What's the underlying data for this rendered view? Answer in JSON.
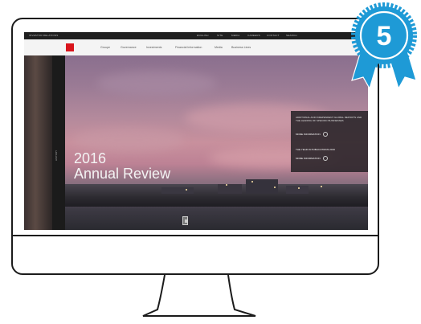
{
  "screen": {
    "top_bar": {
      "left_text": "INVESTOR RELATIONS",
      "right_items": [
        "ENGLISH",
        "SITE",
        "MEDIA",
        "CAREERS",
        "CONTACT",
        "SEARCH"
      ]
    },
    "nav": {
      "items": [
        "Groupe",
        "Governance",
        "Investments",
        "Financial Information",
        "Media",
        "Business Lines"
      ]
    },
    "hero": {
      "year": "2016",
      "title": "Annual Review",
      "side_label": "HISTORY"
    },
    "info_box": {
      "headline": "ADDITIONAL AND INDEPENDENT GLOBAL REPORTS AND THE LEADING OF SPECIFIC BUSINESSES",
      "link1": "MORE INFORMATION",
      "subhead": "THE YEAR IN PUBLICATIONS 2016",
      "link2": "MORE INFORMATION"
    }
  },
  "badge": {
    "number": "5",
    "color": "#1e9ad6"
  },
  "colors": {
    "brand_red": "#d9151c",
    "monitor_outline": "#1b1b1b"
  }
}
